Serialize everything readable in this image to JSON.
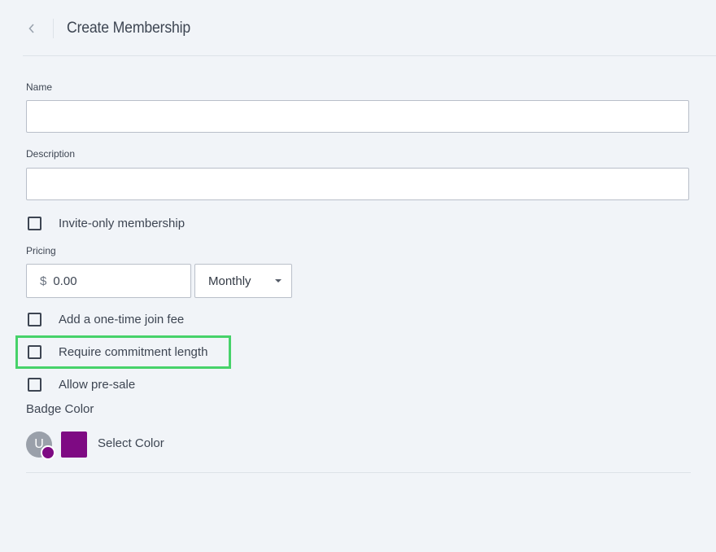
{
  "header": {
    "title": "Create Membership",
    "back_icon": "chevron-left-icon"
  },
  "form": {
    "name_label": "Name",
    "name_value": "",
    "description_label": "Description",
    "description_value": "",
    "invite_only_label": "Invite-only membership",
    "pricing_label": "Pricing",
    "currency_symbol": "$",
    "price_value": "0.00",
    "period_selected": "Monthly",
    "join_fee_label": "Add a one-time join fee",
    "commitment_label": "Require commitment length",
    "presale_label": "Allow pre-sale",
    "badge_color_label": "Badge Color",
    "avatar_initial": "U",
    "select_color_label": "Select Color"
  },
  "colors": {
    "badge": "#7e0a83",
    "highlight": "#47d26a",
    "background": "#f1f4f8"
  }
}
